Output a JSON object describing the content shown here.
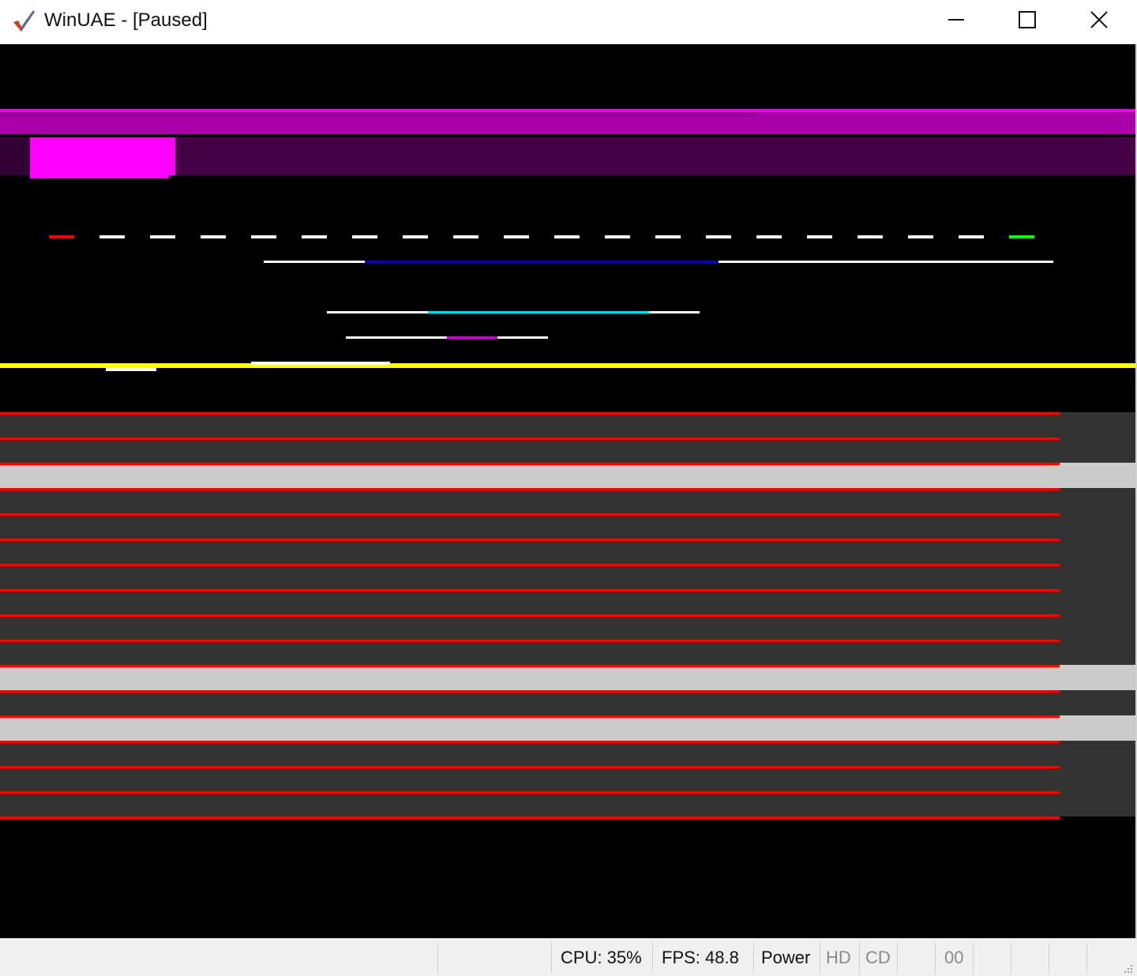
{
  "window": {
    "title": "WinUAE - [Paused]",
    "app_icon": "winuae-checkmark-icon",
    "controls": [
      "minimize-icon",
      "maximize-icon",
      "close-icon"
    ]
  },
  "status_bar": {
    "cpu": "CPU: 35%",
    "fps": "FPS: 48.8",
    "power": "Power",
    "hd": "HD",
    "cd": "CD",
    "drive": "00"
  },
  "colors": {
    "magenta": "#ff00ff",
    "purple": "#aa00aa",
    "dark_purple": "#440044",
    "red": "#ff0000",
    "yellow": "#ffff00",
    "blue": "#0000cc",
    "cyan": "#00e0e0",
    "green": "#00ff00",
    "grey_band": "#333333",
    "light_band": "#cccccc"
  }
}
